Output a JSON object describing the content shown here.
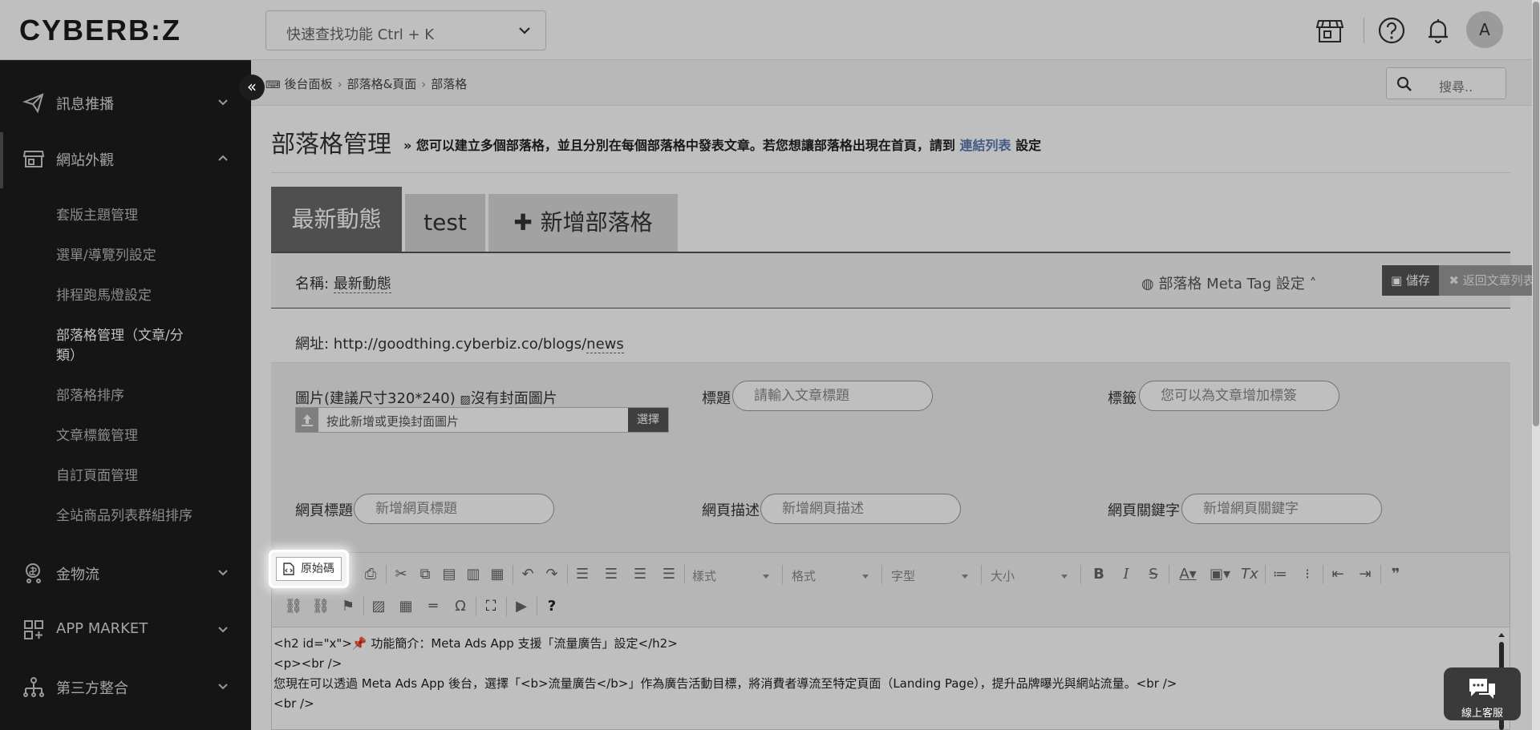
{
  "header": {
    "logo": "CYBERB:Z",
    "quick_search_placeholder": "快速查找功能 Ctrl + K",
    "avatar_letter": "A"
  },
  "sidebar": {
    "sections": [
      {
        "label": "訊息推播"
      },
      {
        "label": "網站外觀"
      },
      {
        "label": "金物流"
      },
      {
        "label": "APP MARKET"
      },
      {
        "label": "第三方整合"
      }
    ],
    "sub_items": [
      {
        "label": "套版主題管理"
      },
      {
        "label": "選單/導覽列設定"
      },
      {
        "label": "排程跑馬燈設定"
      },
      {
        "label": "部落格管理（文章/分類）"
      },
      {
        "label": "部落格排序"
      },
      {
        "label": "文章標籤管理"
      },
      {
        "label": "自訂頁面管理"
      },
      {
        "label": "全站商品列表群組排序"
      }
    ],
    "collapse_label": "«"
  },
  "breadcrumb": {
    "items": [
      "後台面板",
      "部落格&頁面",
      "部落格"
    ],
    "sep": "›"
  },
  "top_search_placeholder": "搜尋..",
  "page": {
    "title": "部落格管理",
    "hint_prefix": "» 您可以建立多個部落格，並且分別在每個部落格中發表文章。若您想讓部落格出現在首頁，請到 ",
    "hint_link": "連結列表",
    "hint_suffix": " 設定"
  },
  "tabs": [
    {
      "label": "最新動態"
    },
    {
      "label": "test"
    },
    {
      "label": "新增部落格"
    }
  ],
  "blog": {
    "name_label": "名稱: ",
    "name_value": "最新動態",
    "meta_tag_label": "部落格 Meta Tag 設定",
    "save_label": "儲存",
    "back_label": "返回文章列表",
    "url_label": "網址: ",
    "url_prefix": "http://goodthing.cyberbiz.co/blogs/",
    "url_slug": "news"
  },
  "form": {
    "image_label": "圖片(建議尺寸320*240)",
    "no_cover_alt": "沒有封面圖片",
    "upload_placeholder": "按此新增或更換封面圖片",
    "upload_button": "選擇",
    "title_label": "標題",
    "title_placeholder": "請輸入文章標題",
    "tags_label": "標籤",
    "tags_placeholder": "您可以為文章增加標簽",
    "page_title_label": "網頁標題",
    "page_title_placeholder": "新增網頁標題",
    "page_desc_label": "網頁描述",
    "page_desc_placeholder": "新增網頁描述",
    "page_keywords_label": "網頁關鍵字",
    "page_keywords_placeholder": "新增網頁關鍵字"
  },
  "editor": {
    "source_label": "原始碼",
    "style_drop": "樣式",
    "format_drop": "格式",
    "font_drop": "字型",
    "size_drop": "大小",
    "help_label": "?",
    "lines": [
      "<h2 id=\"x\">📌 功能簡介：Meta Ads App 支援「流量廣告」設定</h2>",
      "",
      "<p><br />",
      "您現在可以透過 Meta Ads App 後台，選擇「<b>流量廣告</b>」作為廣告活動目標，將消費者導流至特定頁面（Landing Page），提升品牌曝光與網站流量。<br />",
      "<br />"
    ]
  },
  "chat": {
    "label": "線上客服"
  }
}
